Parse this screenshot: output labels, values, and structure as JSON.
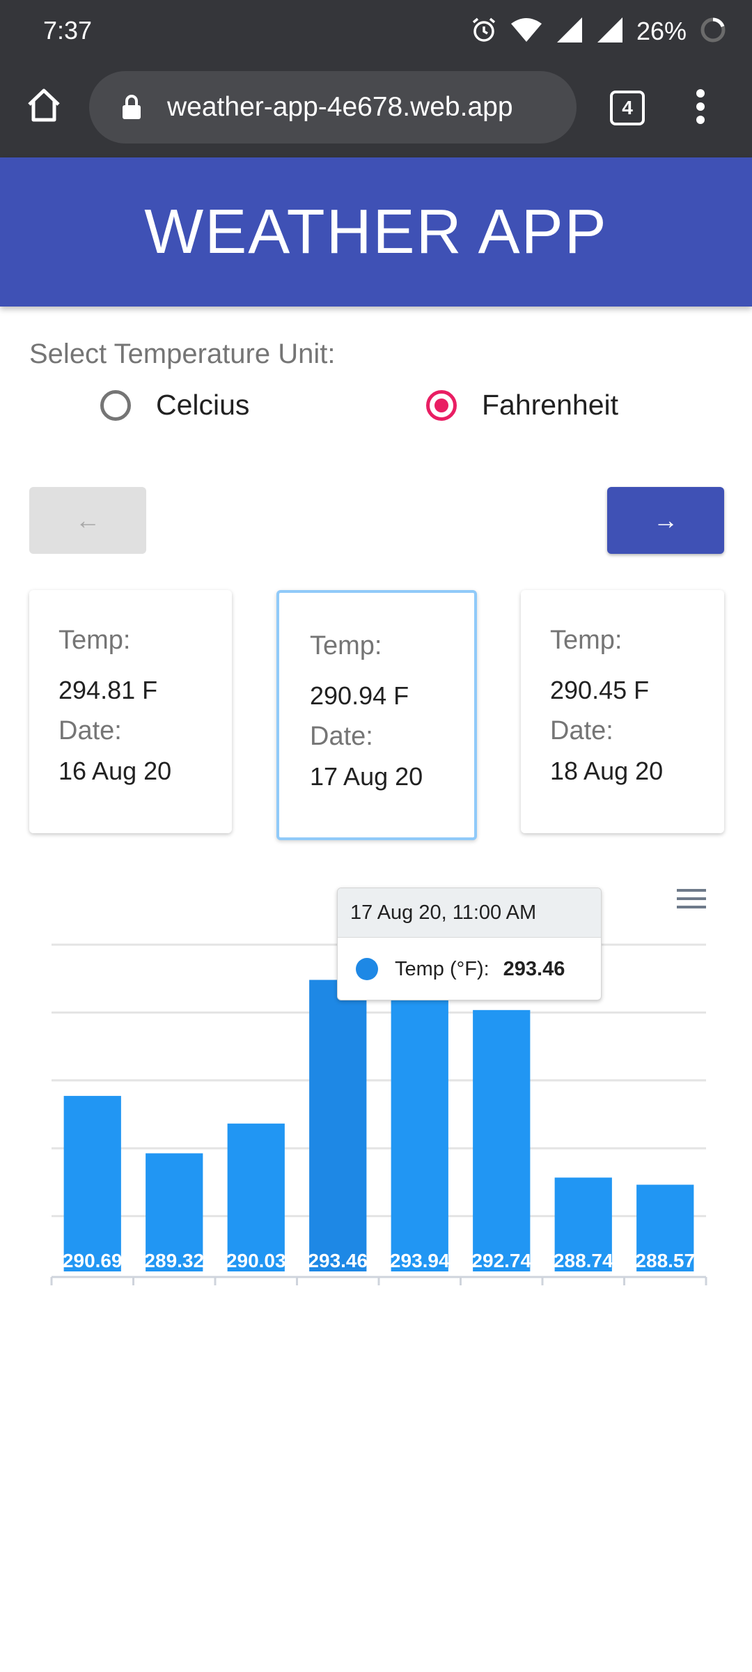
{
  "status_bar": {
    "time": "7:37",
    "battery_percent": "26%",
    "icons": [
      "alarm-icon",
      "wifi-icon",
      "signal-icon",
      "signal-icon",
      "battery-icon"
    ]
  },
  "browser": {
    "url": "weather-app-4e678.web.app",
    "tab_count": "4",
    "icons": [
      "home-icon",
      "lock-icon",
      "tabs-icon",
      "more-vert-icon"
    ]
  },
  "app": {
    "title": "WEATHER APP",
    "header_color": "#3f51b5"
  },
  "unit_selector": {
    "label": "Select Temperature Unit:",
    "options": [
      {
        "label": "Celcius",
        "checked": false
      },
      {
        "label": "Fahrenheit",
        "checked": true
      }
    ],
    "accent": "#e91e63"
  },
  "navigation": {
    "prev_label": "←",
    "next_label": "→",
    "prev_disabled": true
  },
  "cards": [
    {
      "temp_label": "Temp:",
      "temp": "294.81 F",
      "date_label": "Date:",
      "date": "16 Aug 20",
      "selected": false
    },
    {
      "temp_label": "Temp:",
      "temp": "290.94 F",
      "date_label": "Date:",
      "date": "17 Aug 20",
      "selected": true
    },
    {
      "temp_label": "Temp:",
      "temp": "290.45 F",
      "date_label": "Date:",
      "date": "18 Aug 20",
      "selected": false
    }
  ],
  "tooltip": {
    "title": "17 Aug 20, 11:00 AM",
    "series_label": "Temp (°F):",
    "value": "293.46"
  },
  "chart_data": {
    "type": "bar",
    "values": [
      290.69,
      289.32,
      290.03,
      293.46,
      293.94,
      292.74,
      288.74,
      288.57
    ],
    "data_labels": [
      "290.69",
      "289.32",
      "290.03",
      "293.46",
      "293.94",
      "292.74",
      "288.74",
      "288.57"
    ],
    "highlighted_index": 3,
    "bar_color": "#2196f3",
    "highlight_color": "#1e88e5",
    "grid": true,
    "menu_icon": "hamburger-menu-icon"
  }
}
